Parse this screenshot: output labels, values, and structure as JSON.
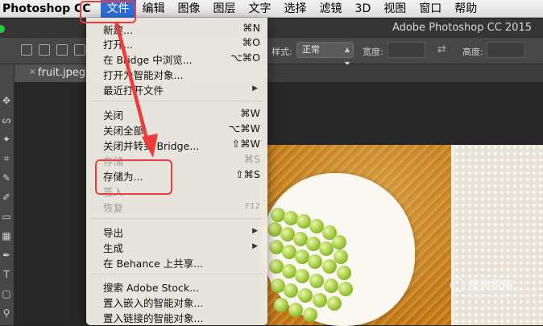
{
  "menubar": {
    "app_name": "Photoshop CC",
    "items": [
      "文件",
      "编辑",
      "图像",
      "图层",
      "文字",
      "选择",
      "滤镜",
      "3D",
      "视图",
      "窗口",
      "帮助"
    ],
    "active_index": 0
  },
  "window": {
    "title": "Adobe Photoshop CC 2015"
  },
  "options_bar": {
    "style_label": "样式:",
    "style_value": "正常",
    "width_label": "宽度:",
    "height_label": "高度:"
  },
  "document_tab": {
    "label": "fruit.jpeg (",
    "close": "×"
  },
  "file_menu": {
    "items": [
      {
        "label": "新建...",
        "shortcut": "⌘N",
        "enabled": true
      },
      {
        "label": "打开...",
        "shortcut": "⌘O",
        "enabled": true
      },
      {
        "label": "在 Bridge 中浏览...",
        "shortcut": "⌥⌘O",
        "enabled": true
      },
      {
        "label": "打开为智能对象...",
        "shortcut": "",
        "enabled": true
      },
      {
        "label": "最近打开文件",
        "shortcut": "",
        "enabled": true,
        "submenu": true
      },
      {
        "label": "关闭",
        "shortcut": "⌘W",
        "enabled": true
      },
      {
        "label": "关闭全部",
        "shortcut": "⌥⌘W",
        "enabled": true
      },
      {
        "label": "关闭并转到 Bridge...",
        "shortcut": "⇧⌘W",
        "enabled": true
      },
      {
        "label": "存储",
        "shortcut": "⌘S",
        "enabled": false
      },
      {
        "label": "存储为...",
        "shortcut": "⇧⌘S",
        "enabled": true
      },
      {
        "label": "签入",
        "shortcut": "",
        "enabled": false
      },
      {
        "label": "恢复",
        "shortcut": "F12",
        "enabled": false
      },
      {
        "label": "导出",
        "shortcut": "",
        "enabled": true,
        "submenu": true
      },
      {
        "label": "生成",
        "shortcut": "",
        "enabled": true,
        "submenu": true
      },
      {
        "label": "在 Behance 上共享...",
        "shortcut": "",
        "enabled": true
      },
      {
        "label": "搜索 Adobe Stock...",
        "shortcut": "",
        "enabled": true
      },
      {
        "label": "置入嵌入的智能对象...",
        "shortcut": "",
        "enabled": true
      },
      {
        "label": "置入链接的智能对象...",
        "shortcut": "",
        "enabled": true
      }
    ],
    "submenu_glyph": "▶"
  },
  "annotations": {
    "highlight_color": "#ef3b3b"
  },
  "watermark": {
    "main": "搜狗指南",
    "sub": "zhinan.sogou.com"
  },
  "colors": {
    "menu_accent": "#2f6ddb",
    "annotation": "#ef3b3b"
  }
}
